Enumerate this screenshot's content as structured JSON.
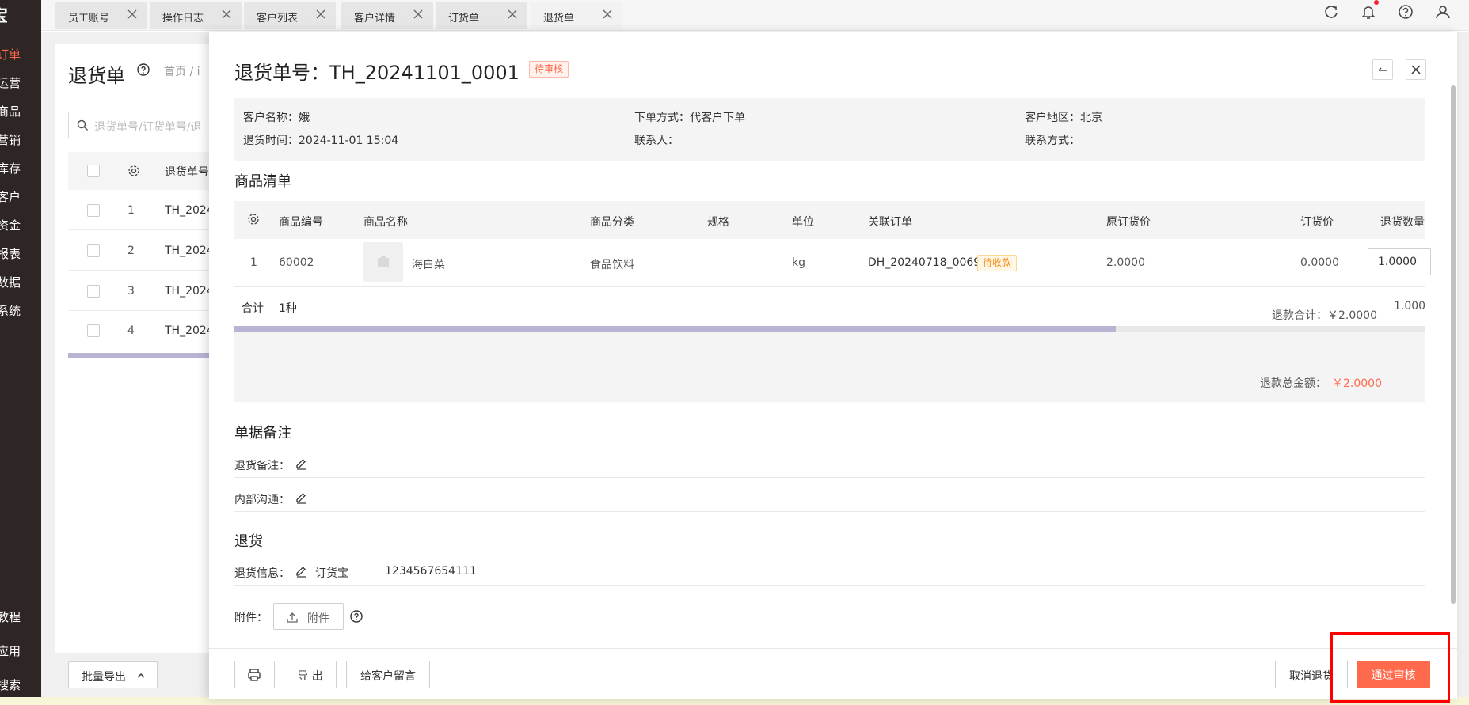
{
  "sidebar": {
    "logo": "宝",
    "items": [
      {
        "label": "订单",
        "active": true
      },
      {
        "label": "运营"
      },
      {
        "label": "商品"
      },
      {
        "label": "营销"
      },
      {
        "label": "库存"
      },
      {
        "label": "客户"
      },
      {
        "label": "资金"
      },
      {
        "label": "报表"
      },
      {
        "label": "数据"
      },
      {
        "label": "系统"
      }
    ],
    "bottom_items": [
      {
        "label": "教程"
      },
      {
        "label": "应用"
      },
      {
        "label": "搜索"
      }
    ]
  },
  "tabs": [
    {
      "label": "员工账号"
    },
    {
      "label": "操作日志"
    },
    {
      "label": "客户列表"
    },
    {
      "label": "客户详情"
    },
    {
      "label": "订货单"
    },
    {
      "label": "退货单",
      "active": true
    }
  ],
  "background_page": {
    "title": "退货单",
    "breadcrumb": "首页  /  i",
    "search_placeholder": "退货单号/订货单号/退",
    "column_header": "退货单号",
    "rows": [
      {
        "index": "1",
        "code": "TH_2024"
      },
      {
        "index": "2",
        "code": "TH_2024"
      },
      {
        "index": "3",
        "code": "TH_2024"
      },
      {
        "index": "4",
        "code": "TH_2024"
      }
    ],
    "batch_export_label": "批量导出"
  },
  "drawer": {
    "title": "退货单号：TH_20241101_0001",
    "status_badge": "待审核",
    "info": {
      "customer_name": "客户名称：娥",
      "order_method": "下单方式：代客户下单",
      "customer_region": "客户地区：北京",
      "return_time": "退货时间：2024-11-01 15:04",
      "contact_person": "联系人：",
      "contact_method": "联系方式："
    },
    "goods_section_title": "商品清单",
    "goods_columns": [
      "商品编号",
      "商品名称",
      "商品分类",
      "规格",
      "单位",
      "关联订单",
      "原订货价",
      "订货价",
      "退货数量"
    ],
    "goods_rows": [
      {
        "index": "1",
        "code": "60002",
        "name": "海白菜",
        "category": "食品饮料",
        "spec": "",
        "unit": "kg",
        "related_order": "DH_20240718_0069",
        "order_status": "待收款",
        "original_price": "2.0000",
        "order_price": "0.0000",
        "return_qty": "1.0000"
      }
    ],
    "summary": {
      "total_label": "合计",
      "kinds": "1种",
      "refund_subtotal": "退款合计：￥2.0000",
      "qty_total": "1.0000",
      "refund_total_label": "退款总金额：",
      "refund_total_value": "￥2.0000"
    },
    "remarks_section_title": "单据备注",
    "return_remark_label": "退货备注：",
    "internal_comm_label": "内部沟通：",
    "return_section_title": "退货",
    "return_info_label": "退货信息：",
    "return_info_company": "订货宝",
    "return_info_number": "1234567654111",
    "attachment_label": "附件：",
    "attachment_button": "附件"
  },
  "footer": {
    "export_label": "导 出",
    "message_label": "给客户留言",
    "cancel_label": "取消退货",
    "approve_label": "通过审核"
  },
  "colors": {
    "accent": "#ff6a4d",
    "sidebar_bg": "#2e2625",
    "scrollbar": "#b9b4d4",
    "highlight": "#ff0000"
  }
}
